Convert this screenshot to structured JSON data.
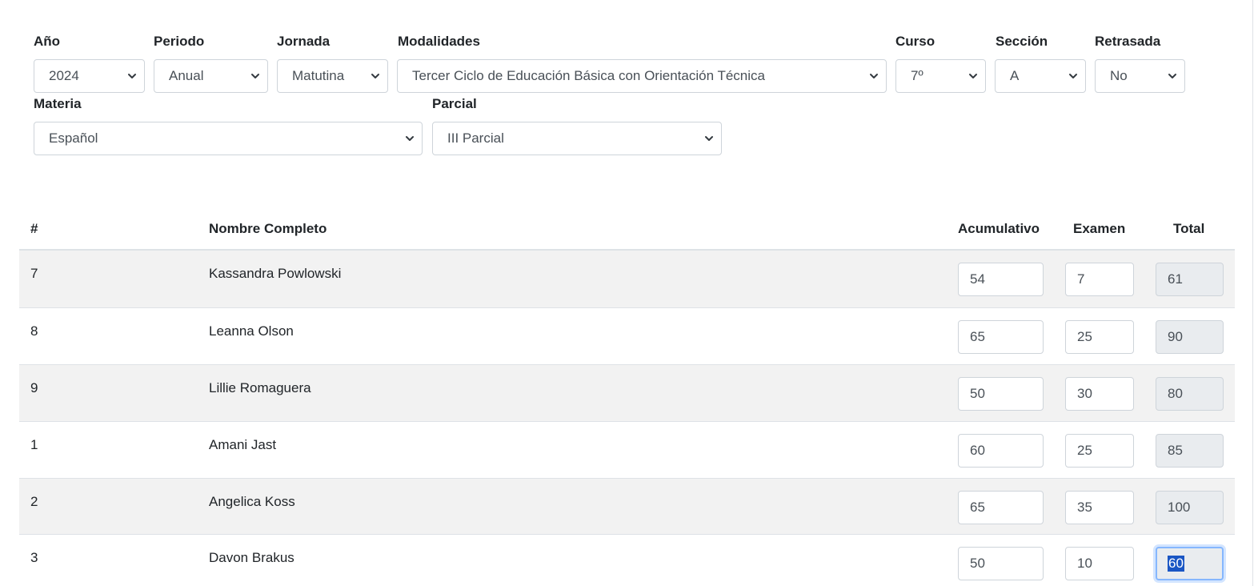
{
  "filters": {
    "anio": {
      "label": "Año",
      "value": "2024"
    },
    "periodo": {
      "label": "Periodo",
      "value": "Anual"
    },
    "jornada": {
      "label": "Jornada",
      "value": "Matutina"
    },
    "modalidades": {
      "label": "Modalidades",
      "value": "Tercer Ciclo de Educación Básica con Orientación Técnica"
    },
    "curso": {
      "label": "Curso",
      "value": "7º"
    },
    "seccion": {
      "label": "Sección",
      "value": "A"
    },
    "retrasada": {
      "label": "Retrasada",
      "value": "No"
    },
    "materia": {
      "label": "Materia",
      "value": "Español"
    },
    "parcial": {
      "label": "Parcial",
      "value": "III Parcial"
    }
  },
  "table": {
    "headers": {
      "num": "#",
      "nombre": "Nombre Completo",
      "acumulativo": "Acumulativo",
      "examen": "Examen",
      "total": "Total"
    },
    "rows": [
      {
        "num": "7",
        "nombre": "Kassandra Powlowski",
        "acumulativo": "54",
        "examen": "7",
        "total": "61"
      },
      {
        "num": "8",
        "nombre": "Leanna Olson",
        "acumulativo": "65",
        "examen": "25",
        "total": "90"
      },
      {
        "num": "9",
        "nombre": "Lillie Romaguera",
        "acumulativo": "50",
        "examen": "30",
        "total": "80"
      },
      {
        "num": "1",
        "nombre": "Amani Jast",
        "acumulativo": "60",
        "examen": "25",
        "total": "85"
      },
      {
        "num": "2",
        "nombre": "Angelica Koss",
        "acumulativo": "65",
        "examen": "35",
        "total": "100"
      },
      {
        "num": "3",
        "nombre": "Davon Brakus",
        "acumulativo": "50",
        "examen": "10",
        "total": "60"
      }
    ]
  },
  "icons": {
    "select_arrow": "chevron-down-icon"
  },
  "colors": {
    "stripe": "#f2f2f2",
    "readonly": "#e9ecef",
    "focus": "#86b7fe",
    "selection": "#1a56c4"
  }
}
